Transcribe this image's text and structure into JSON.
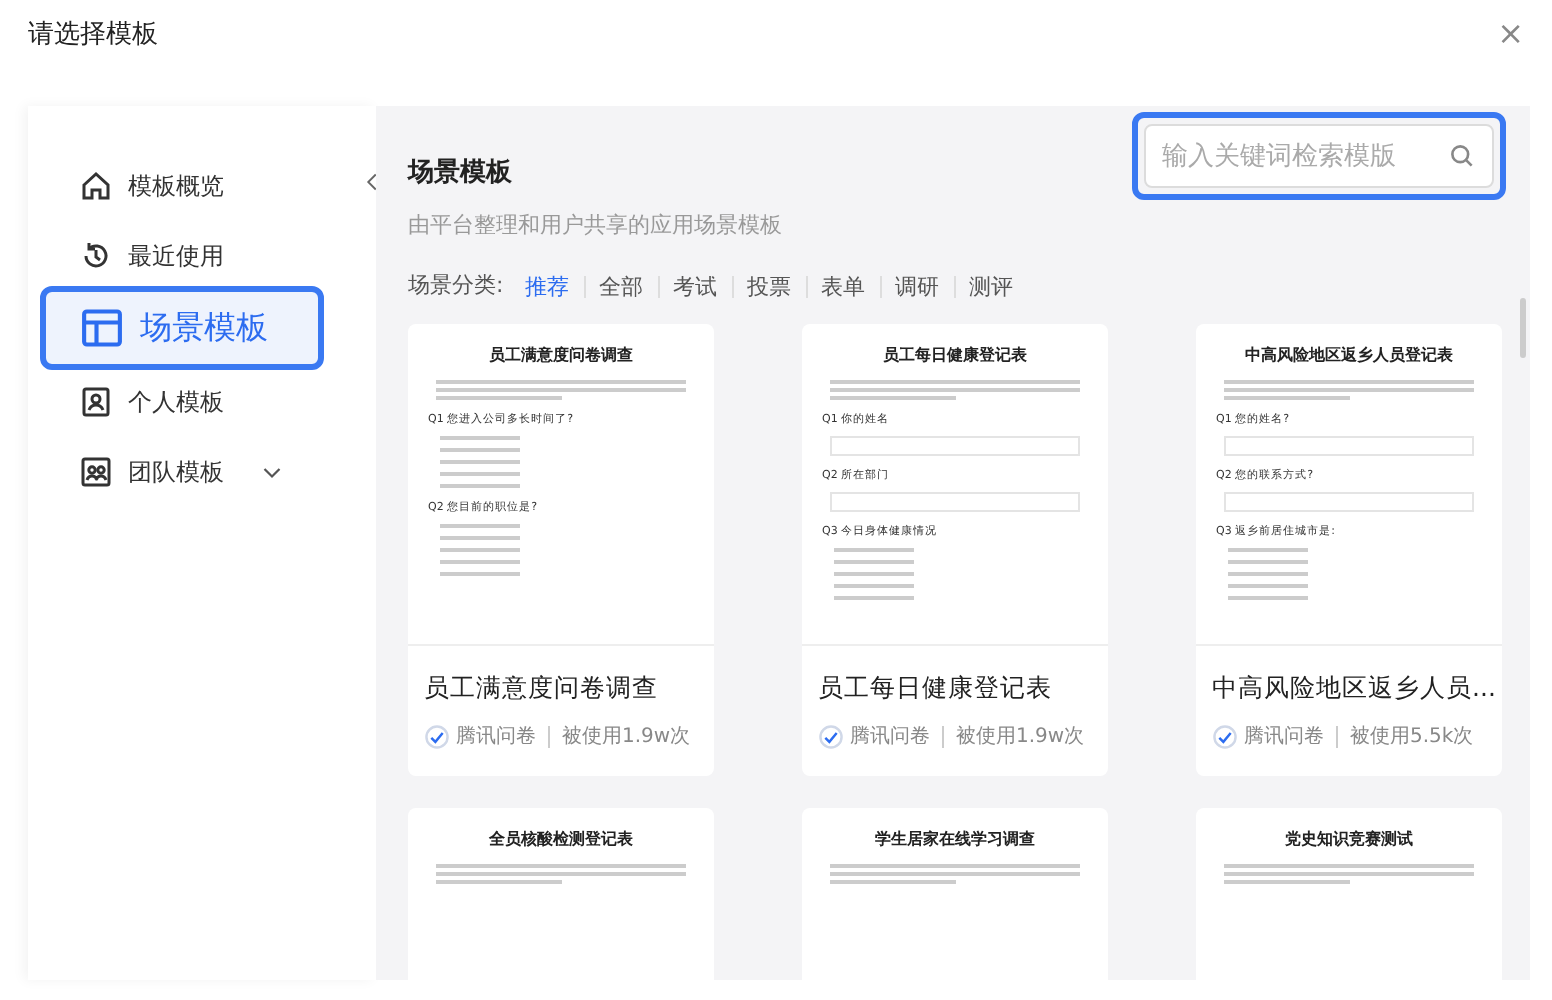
{
  "dialog": {
    "title": "请选择模板",
    "close": "×"
  },
  "sidebar": {
    "items": [
      {
        "label": "模板概览",
        "selected": false,
        "highlighted": false,
        "kind": "link"
      },
      {
        "label": "最近使用",
        "selected": false,
        "highlighted": false,
        "kind": "link"
      },
      {
        "label": "场景模板",
        "selected": true,
        "highlighted": true,
        "kind": "link"
      },
      {
        "label": "个人模板",
        "selected": false,
        "highlighted": false,
        "kind": "link"
      },
      {
        "label": "团队模板",
        "selected": false,
        "highlighted": false,
        "kind": "group"
      }
    ]
  },
  "main": {
    "title": "场景模板",
    "subtitle": "由平台整理和用户共享的应用场景模板",
    "search": {
      "placeholder": "输入关键词检索模版",
      "highlighted": true
    },
    "category_label": "场景分类:",
    "categories": [
      {
        "label": "推荐",
        "selected": true
      },
      {
        "label": "全部",
        "selected": false
      },
      {
        "label": "考试",
        "selected": false
      },
      {
        "label": "投票",
        "selected": false
      },
      {
        "label": "表单",
        "selected": false
      },
      {
        "label": "调研",
        "selected": false
      },
      {
        "label": "测评",
        "selected": false
      }
    ],
    "templates": [
      {
        "preview_title": "员工满意度问卷调查",
        "questions": [
          {
            "label": "Q1 您进入公司多长时间了?",
            "kind": "options"
          },
          {
            "label": "Q2 您目前的职位是?",
            "kind": "options"
          }
        ],
        "title": "员工满意度问卷调查",
        "source": "腾讯问卷",
        "usage": "被使用1.9w次"
      },
      {
        "preview_title": "员工每日健康登记表",
        "questions": [
          {
            "label": "Q1 你的姓名",
            "kind": "input"
          },
          {
            "label": "Q2 所在部门",
            "kind": "input"
          },
          {
            "label": "Q3 今日身体健康情况",
            "kind": "options"
          }
        ],
        "title": "员工每日健康登记表",
        "source": "腾讯问卷",
        "usage": "被使用1.9w次"
      },
      {
        "preview_title": "中高风险地区返乡人员登记表",
        "questions": [
          {
            "label": "Q1 您的姓名?",
            "kind": "input"
          },
          {
            "label": "Q2 您的联系方式?",
            "kind": "input"
          },
          {
            "label": "Q3 返乡前居住城市是:",
            "kind": "options"
          }
        ],
        "title": "中高风险地区返乡人员...",
        "source": "腾讯问卷",
        "usage": "被使用5.5k次"
      },
      {
        "preview_title": "全员核酸检测登记表"
      },
      {
        "preview_title": "学生居家在线学习调查"
      },
      {
        "preview_title": "党史知识竞赛测试"
      }
    ]
  }
}
